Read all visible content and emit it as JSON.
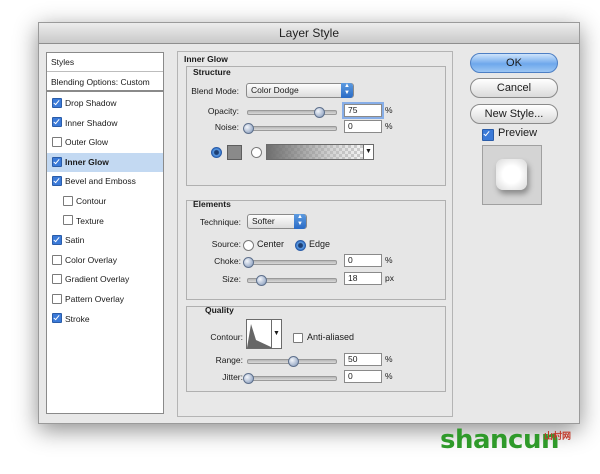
{
  "window": {
    "title": "Layer Style"
  },
  "styles_panel": {
    "header": "Styles",
    "blending": "Blending Options: Custom",
    "items": [
      {
        "label": "Drop Shadow",
        "checked": true
      },
      {
        "label": "Inner Shadow",
        "checked": true
      },
      {
        "label": "Outer Glow",
        "checked": false
      },
      {
        "label": "Inner Glow",
        "checked": true,
        "selected": true
      },
      {
        "label": "Bevel and Emboss",
        "checked": true
      },
      {
        "label": "Contour",
        "checked": false,
        "indent": true
      },
      {
        "label": "Texture",
        "checked": false,
        "indent": true
      },
      {
        "label": "Satin",
        "checked": true
      },
      {
        "label": "Color Overlay",
        "checked": false
      },
      {
        "label": "Gradient Overlay",
        "checked": false
      },
      {
        "label": "Pattern Overlay",
        "checked": false
      },
      {
        "label": "Stroke",
        "checked": true
      }
    ]
  },
  "inner_glow": {
    "title": "Inner Glow",
    "structure": {
      "title": "Structure",
      "blend_mode_label": "Blend Mode:",
      "blend_mode": "Color Dodge",
      "opacity_label": "Opacity:",
      "opacity": "75",
      "opacity_unit": "%",
      "noise_label": "Noise:",
      "noise": "0",
      "noise_unit": "%"
    },
    "elements": {
      "title": "Elements",
      "technique_label": "Technique:",
      "technique": "Softer",
      "source_label": "Source:",
      "source_center": "Center",
      "source_edge": "Edge",
      "choke_label": "Choke:",
      "choke": "0",
      "choke_unit": "%",
      "size_label": "Size:",
      "size": "18",
      "size_unit": "px"
    },
    "quality": {
      "title": "Quality",
      "contour_label": "Contour:",
      "anti_aliased": "Anti-aliased",
      "range_label": "Range:",
      "range": "50",
      "range_unit": "%",
      "jitter_label": "Jitter:",
      "jitter": "0",
      "jitter_unit": "%"
    }
  },
  "buttons": {
    "ok": "OK",
    "cancel": "Cancel",
    "new_style": "New Style...",
    "preview": "Preview"
  },
  "watermark": {
    "site": "shancun",
    "sub": "山村网"
  },
  "colors": {
    "accent": "#3b7ad8",
    "selection": "#c3d9f2",
    "watermark_green": "#2f9a2a"
  }
}
